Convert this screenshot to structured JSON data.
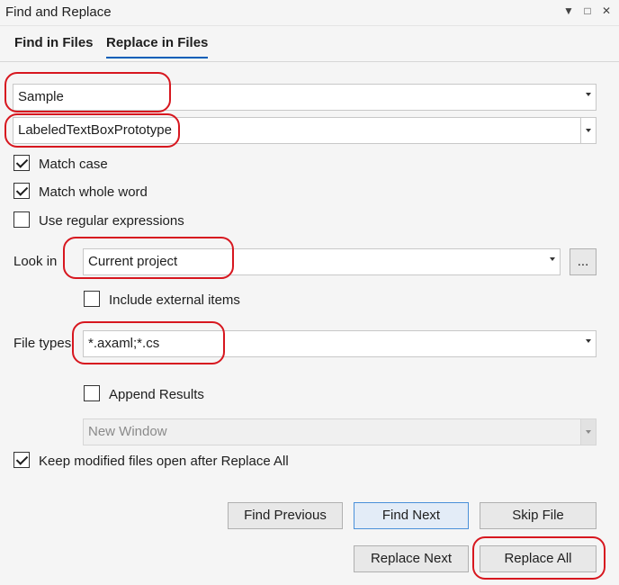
{
  "window": {
    "title": "Find and Replace",
    "controls": {
      "dropdown_icon": "▼",
      "maximize_icon": "□",
      "close_icon": "✕"
    }
  },
  "tabs": [
    {
      "label": "Find in Files",
      "active": false
    },
    {
      "label": "Replace in Files",
      "active": true
    }
  ],
  "find_field": {
    "value": "Sample"
  },
  "replace_field": {
    "value": "LabeledTextBoxPrototype"
  },
  "options": {
    "match_case": {
      "label": "Match case",
      "checked": true
    },
    "match_whole_word": {
      "label": "Match whole word",
      "checked": true
    },
    "use_regex": {
      "label": "Use regular expressions",
      "checked": false
    }
  },
  "look_in": {
    "label": "Look in",
    "value": "Current project",
    "browse_label": "...",
    "include_external": {
      "label": "Include external items",
      "checked": false
    }
  },
  "file_types": {
    "label": "File types",
    "value": "*.axaml;*.cs"
  },
  "results": {
    "append": {
      "label": "Append Results",
      "checked": false
    },
    "window_value": "New Window"
  },
  "keep_open": {
    "label": "Keep modified files open after Replace All",
    "checked": true
  },
  "buttons": {
    "find_previous": "Find Previous",
    "find_next": "Find Next",
    "skip_file": "Skip File",
    "replace_next": "Replace Next",
    "replace_all": "Replace All"
  },
  "annotation_color": "#d7171f"
}
